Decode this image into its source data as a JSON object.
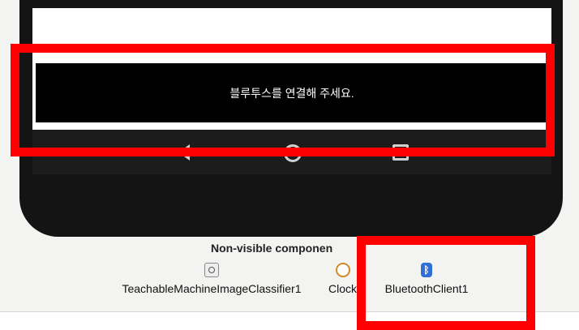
{
  "top_partial_text": "|",
  "phone": {
    "toast_message": "블루투스를 연결해 주세요.",
    "nav": {
      "back_icon": "back-triangle-icon",
      "home_icon": "home-circle-icon",
      "recent_icon": "recent-square-icon"
    }
  },
  "nonvisible": {
    "title": "Non-visible componen",
    "components": [
      {
        "label": "TeachableMachineImageClassifier1",
        "icon": "teachable-machine-icon"
      },
      {
        "label": "Clock",
        "icon": "clock-icon"
      },
      {
        "label": "BluetoothClient1",
        "icon": "bluetooth-icon"
      }
    ]
  },
  "highlights": {
    "color": "#ff0000"
  }
}
